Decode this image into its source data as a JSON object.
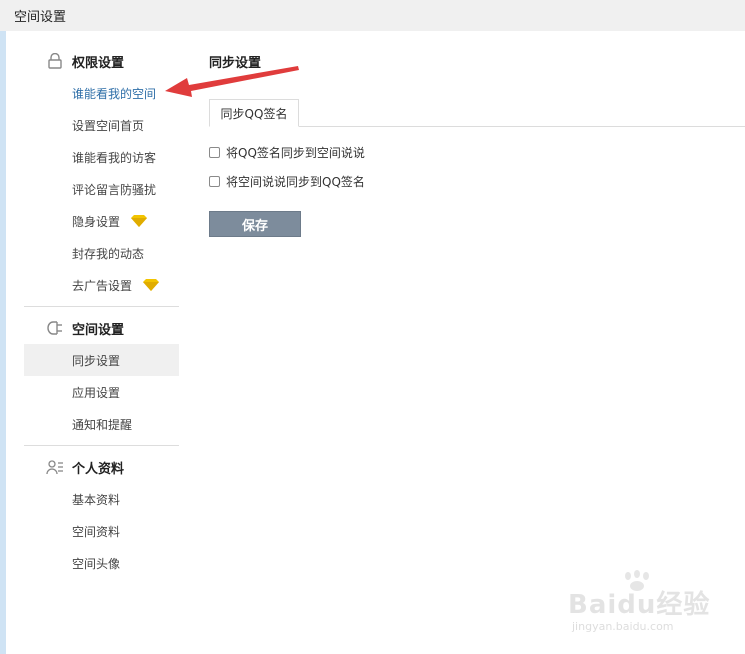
{
  "header": {
    "title": "空间设置"
  },
  "sidebar": {
    "sections": [
      {
        "label": "权限设置",
        "icon": "lock-icon",
        "items": [
          {
            "label": "谁能看我的空间",
            "link": true
          },
          {
            "label": "设置空间首页"
          },
          {
            "label": "谁能看我的访客"
          },
          {
            "label": "评论留言防骚扰"
          },
          {
            "label": "隐身设置",
            "badge": "diamond-icon"
          },
          {
            "label": "封存我的动态"
          },
          {
            "label": "去广告设置",
            "badge": "diamond-icon"
          }
        ]
      },
      {
        "label": "空间设置",
        "icon": "plug-icon",
        "items": [
          {
            "label": "同步设置",
            "active": true
          },
          {
            "label": "应用设置"
          },
          {
            "label": "通知和提醒"
          }
        ]
      },
      {
        "label": "个人资料",
        "icon": "profile-icon",
        "items": [
          {
            "label": "基本资料"
          },
          {
            "label": "空间资料"
          },
          {
            "label": "空间头像"
          }
        ]
      }
    ]
  },
  "main": {
    "title": "同步设置",
    "tab": "同步QQ签名",
    "options": [
      {
        "label": "将QQ签名同步到空间说说",
        "checked": false
      },
      {
        "label": "将空间说说同步到QQ签名",
        "checked": false
      }
    ],
    "save_label": "保存"
  },
  "watermark": {
    "text": "Baidu经验",
    "sub": "jingyan.baidu.com"
  },
  "colors": {
    "accent_link": "#2f6fa8",
    "gem": "#f2c400",
    "arrow": "#e03c3c",
    "save_button": "#7d8c9c"
  }
}
